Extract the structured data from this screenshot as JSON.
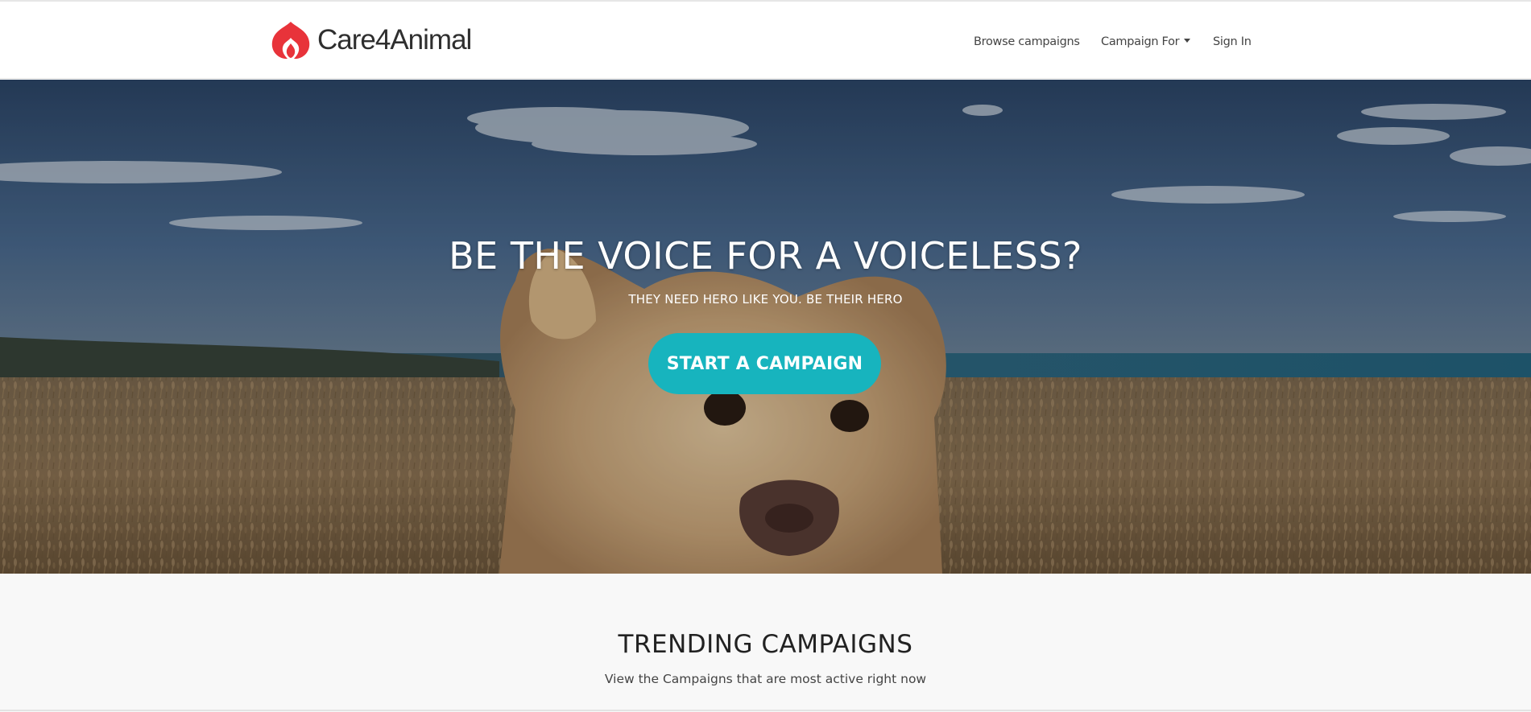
{
  "nav": {
    "brand_name": "Care4Animal",
    "logo_icon": "heart-flame-logo",
    "brand_color": "#e8333a",
    "links": {
      "browse": "Browse campaigns",
      "campaign_for": "Campaign For",
      "sign_in": "Sign In"
    }
  },
  "hero": {
    "title": "BE THE VOICE FOR A VOICELESS?",
    "subtitle": "THEY NEED HERO LIKE YOU. BE THEIR HERO",
    "cta_label": "START A CAMPAIGN",
    "cta_color": "#17b4be"
  },
  "trending": {
    "title": "TRENDING CAMPAIGNS",
    "subtitle": "View the Campaigns that are most active right now"
  }
}
